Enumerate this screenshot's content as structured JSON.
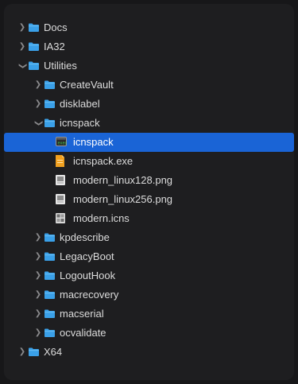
{
  "tree": {
    "rows": [
      {
        "label": "Docs",
        "icon": "folder-icon",
        "expanded": false
      },
      {
        "label": "IA32",
        "icon": "folder-icon",
        "expanded": false
      },
      {
        "label": "Utilities",
        "icon": "folder-icon",
        "expanded": true
      },
      {
        "label": "CreateVault",
        "icon": "folder-icon",
        "expanded": false
      },
      {
        "label": "disklabel",
        "icon": "folder-icon",
        "expanded": false
      },
      {
        "label": "icnspack",
        "icon": "folder-icon",
        "expanded": true
      },
      {
        "label": "icnspack",
        "icon": "executable-icon",
        "selected": true
      },
      {
        "label": "icnspack.exe",
        "icon": "exe-file-icon"
      },
      {
        "label": "modern_linux128.png",
        "icon": "image-file-icon"
      },
      {
        "label": "modern_linux256.png",
        "icon": "image-file-icon"
      },
      {
        "label": "modern.icns",
        "icon": "icns-file-icon"
      },
      {
        "label": "kpdescribe",
        "icon": "folder-icon",
        "expanded": false
      },
      {
        "label": "LegacyBoot",
        "icon": "folder-icon",
        "expanded": false
      },
      {
        "label": "LogoutHook",
        "icon": "folder-icon",
        "expanded": false
      },
      {
        "label": "macrecovery",
        "icon": "folder-icon",
        "expanded": false
      },
      {
        "label": "macserial",
        "icon": "folder-icon",
        "expanded": false
      },
      {
        "label": "ocvalidate",
        "icon": "folder-icon",
        "expanded": false
      },
      {
        "label": "X64",
        "icon": "folder-icon",
        "expanded": false
      }
    ]
  },
  "colors": {
    "background": "#1e1e20",
    "selection": "#1a64d6",
    "folder": "#3aa0e8",
    "text": "#dcdcdc"
  }
}
